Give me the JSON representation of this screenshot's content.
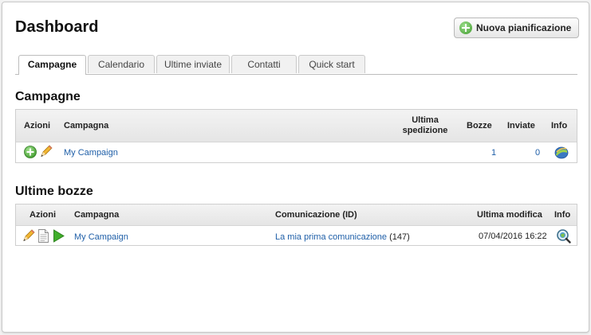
{
  "page": {
    "title": "Dashboard"
  },
  "actions": {
    "new_plan_label": "Nuova pianificazione"
  },
  "tabs": [
    {
      "label": "Campagne",
      "active": true
    },
    {
      "label": "Calendario",
      "active": false
    },
    {
      "label": "Ultime inviate",
      "active": false
    },
    {
      "label": "Contatti",
      "active": false
    },
    {
      "label": "Quick start",
      "active": false
    }
  ],
  "campaigns": {
    "title": "Campagne",
    "headers": {
      "actions": "Azioni",
      "campaign": "Campagna",
      "last_shipment": "Ultima spedizione",
      "drafts": "Bozze",
      "sent": "Inviate",
      "info": "Info"
    },
    "rows": [
      {
        "campaign": "My Campaign",
        "last_shipment": "",
        "drafts": "1",
        "sent": "0",
        "action_icons": [
          "add-icon",
          "pencil-icon"
        ],
        "info_icon": "chart-icon"
      }
    ]
  },
  "drafts": {
    "title": "Ultime bozze",
    "headers": {
      "actions": "Azioni",
      "campaign": "Campagna",
      "communication": "Comunicazione (ID)",
      "last_modified": "Ultima modifica",
      "info": "Info"
    },
    "rows": [
      {
        "campaign": "My Campaign",
        "communication": "La mia prima comunicazione",
        "communication_id": "(147)",
        "last_modified": "07/04/2016 16:22",
        "action_icons": [
          "pencil-icon",
          "document-icon",
          "play-icon"
        ],
        "info_icon": "magnifier-icon"
      }
    ]
  },
  "colors": {
    "link": "#1f5fa8",
    "accent_green": "#3f9a2c"
  }
}
